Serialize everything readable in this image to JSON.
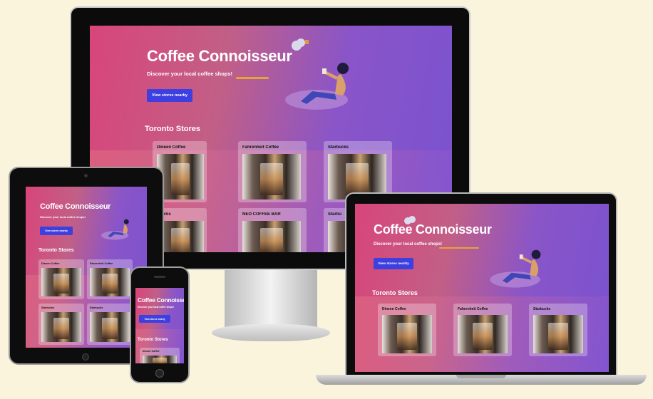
{
  "site": {
    "title": "Coffee Connoisseur",
    "subtitle": "Discover your local coffee shops!",
    "button_label": "View stores nearby",
    "section_title": "Toronto Stores"
  },
  "desktop": {
    "stores": [
      "Dineen Coffee",
      "Fahrenheit Coffee",
      "Starbucks",
      "rbucks",
      "NEO COFFEE BAR",
      "Starbu"
    ]
  },
  "tablet": {
    "stores": [
      "Dineen Coffee",
      "Fahrenheit Coffee",
      "Starbucks",
      "Starbucks"
    ]
  },
  "laptop": {
    "stores": [
      "Dineen Coffee",
      "Fahrenheit Coffee",
      "Starbucks"
    ]
  },
  "phone": {
    "stores": [
      "Dineen Coffee"
    ]
  },
  "colors": {
    "background": "#fbf4dc",
    "button": "#3d3fe0",
    "gradient_start": "#d8457a",
    "gradient_end": "#7a52d0"
  },
  "icons": [
    "girl-with-coffee-illustration",
    "cloud-icon",
    "coffee-cup-icon"
  ]
}
